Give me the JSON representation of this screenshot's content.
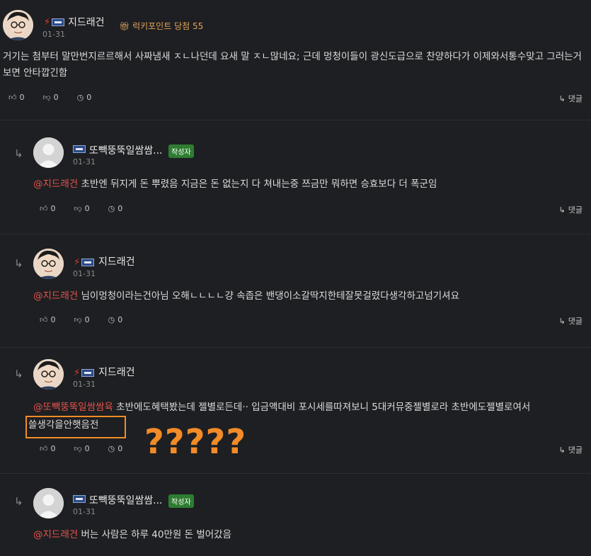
{
  "comments": [
    {
      "nick": "지드래건",
      "date": "01-31",
      "lucky": "럭키포인트 당첨 55",
      "text": "거기는 첨부터 말만번지르르해서 사짜냄새 ㅈㄴ나던데 요새 말 ㅈㄴ많네요; 근데 멍청이들이 광신도급으로 찬양하다가 이제와서통수맞고 그러는거보면 안타깝긴함",
      "likes": "0",
      "dislikes": "0",
      "other": "0",
      "reply_label": "댓글"
    },
    {
      "nick": "또빽뚱뚝일쌈쌈...",
      "badge": "작성자",
      "date": "01-31",
      "mention": "@지드래건",
      "text": "초반엔 뒤지게 돈 뿌렸음 지금은 돈 없는지 다 쳐내는중 쯔금만 뭐하면 승효보다 더 폭군임",
      "likes": "0",
      "dislikes": "0",
      "other": "0",
      "reply_label": "댓글"
    },
    {
      "nick": "지드래건",
      "date": "01-31",
      "mention": "@지드래건",
      "text": "님이멍청이라는건아님 오해ㄴㄴㄴㄴ걍 속좁은 밴댕이소갈딱지한테잘못걸렸다생각하고넘기셔요",
      "likes": "0",
      "dislikes": "0",
      "other": "0",
      "reply_label": "댓글"
    },
    {
      "nick": "지드래건",
      "date": "01-31",
      "mention": "@또빽뚱뚝일쌈쌈육",
      "text_line1": "초반에도혜택봤는데 젤별로든데·· 입금액대비 포시세를따져보니 5대커뮤중젤별로라 초반에도젤별로여서",
      "text_line2": "쓸생각을안햇음전",
      "likes": "0",
      "dislikes": "0",
      "other": "0",
      "reply_label": "댓글"
    },
    {
      "nick": "또빽뚱뚝일쌈쌈...",
      "badge": "작성자",
      "date": "01-31",
      "mention": "@지드래건",
      "text": "버는 사람은 하루 40만원 돈 벌어갔음"
    }
  ],
  "annotation": "?????",
  "colors": {
    "background": "#1e1f22",
    "mention": "#e5534b",
    "highlight": "#f28c28",
    "badge": "#2e7d32"
  }
}
